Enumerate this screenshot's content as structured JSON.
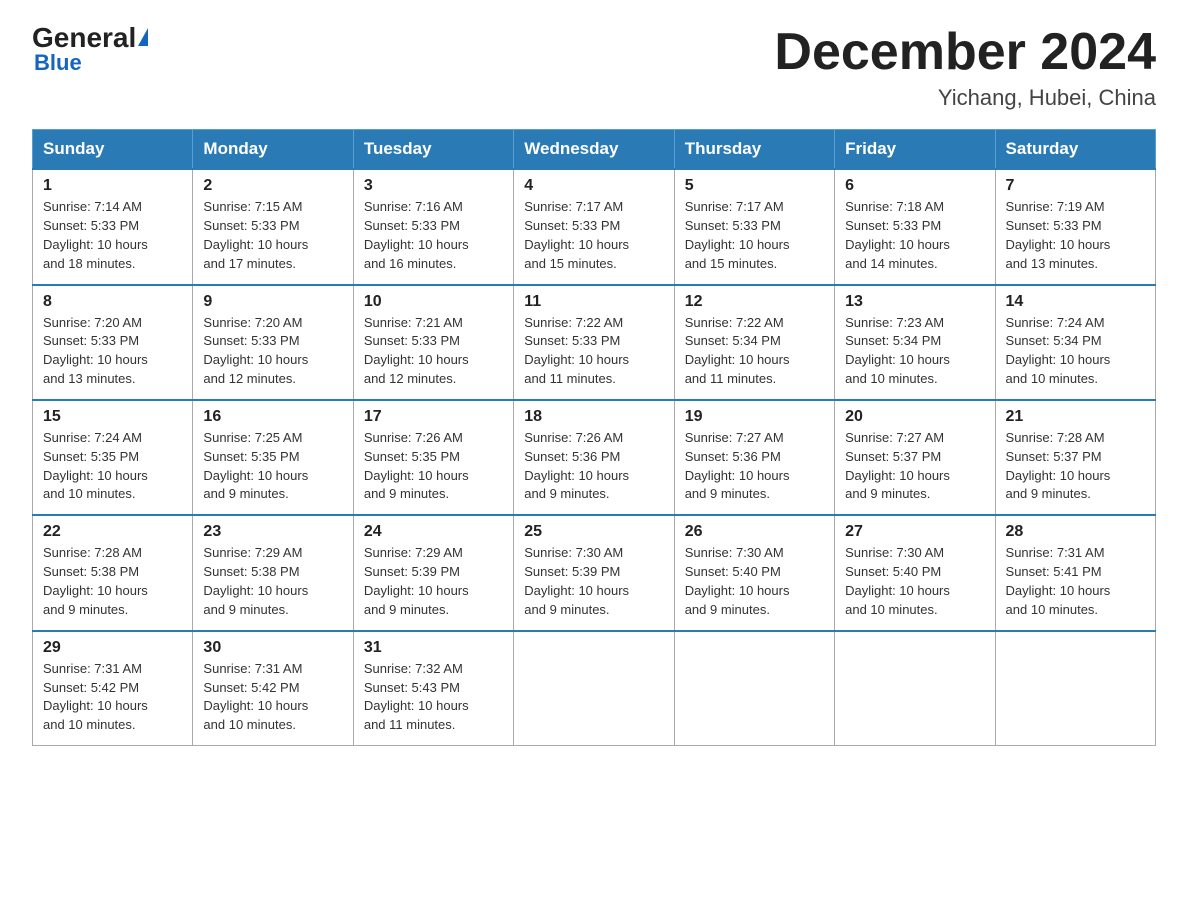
{
  "logo": {
    "general": "General",
    "blue": "Blue",
    "sub": "Blue"
  },
  "header": {
    "title": "December 2024",
    "location": "Yichang, Hubei, China"
  },
  "days_of_week": [
    "Sunday",
    "Monday",
    "Tuesday",
    "Wednesday",
    "Thursday",
    "Friday",
    "Saturday"
  ],
  "weeks": [
    [
      {
        "day": "1",
        "sunrise": "7:14 AM",
        "sunset": "5:33 PM",
        "daylight": "10 hours and 18 minutes."
      },
      {
        "day": "2",
        "sunrise": "7:15 AM",
        "sunset": "5:33 PM",
        "daylight": "10 hours and 17 minutes."
      },
      {
        "day": "3",
        "sunrise": "7:16 AM",
        "sunset": "5:33 PM",
        "daylight": "10 hours and 16 minutes."
      },
      {
        "day": "4",
        "sunrise": "7:17 AM",
        "sunset": "5:33 PM",
        "daylight": "10 hours and 15 minutes."
      },
      {
        "day": "5",
        "sunrise": "7:17 AM",
        "sunset": "5:33 PM",
        "daylight": "10 hours and 15 minutes."
      },
      {
        "day": "6",
        "sunrise": "7:18 AM",
        "sunset": "5:33 PM",
        "daylight": "10 hours and 14 minutes."
      },
      {
        "day": "7",
        "sunrise": "7:19 AM",
        "sunset": "5:33 PM",
        "daylight": "10 hours and 13 minutes."
      }
    ],
    [
      {
        "day": "8",
        "sunrise": "7:20 AM",
        "sunset": "5:33 PM",
        "daylight": "10 hours and 13 minutes."
      },
      {
        "day": "9",
        "sunrise": "7:20 AM",
        "sunset": "5:33 PM",
        "daylight": "10 hours and 12 minutes."
      },
      {
        "day": "10",
        "sunrise": "7:21 AM",
        "sunset": "5:33 PM",
        "daylight": "10 hours and 12 minutes."
      },
      {
        "day": "11",
        "sunrise": "7:22 AM",
        "sunset": "5:33 PM",
        "daylight": "10 hours and 11 minutes."
      },
      {
        "day": "12",
        "sunrise": "7:22 AM",
        "sunset": "5:34 PM",
        "daylight": "10 hours and 11 minutes."
      },
      {
        "day": "13",
        "sunrise": "7:23 AM",
        "sunset": "5:34 PM",
        "daylight": "10 hours and 10 minutes."
      },
      {
        "day": "14",
        "sunrise": "7:24 AM",
        "sunset": "5:34 PM",
        "daylight": "10 hours and 10 minutes."
      }
    ],
    [
      {
        "day": "15",
        "sunrise": "7:24 AM",
        "sunset": "5:35 PM",
        "daylight": "10 hours and 10 minutes."
      },
      {
        "day": "16",
        "sunrise": "7:25 AM",
        "sunset": "5:35 PM",
        "daylight": "10 hours and 9 minutes."
      },
      {
        "day": "17",
        "sunrise": "7:26 AM",
        "sunset": "5:35 PM",
        "daylight": "10 hours and 9 minutes."
      },
      {
        "day": "18",
        "sunrise": "7:26 AM",
        "sunset": "5:36 PM",
        "daylight": "10 hours and 9 minutes."
      },
      {
        "day": "19",
        "sunrise": "7:27 AM",
        "sunset": "5:36 PM",
        "daylight": "10 hours and 9 minutes."
      },
      {
        "day": "20",
        "sunrise": "7:27 AM",
        "sunset": "5:37 PM",
        "daylight": "10 hours and 9 minutes."
      },
      {
        "day": "21",
        "sunrise": "7:28 AM",
        "sunset": "5:37 PM",
        "daylight": "10 hours and 9 minutes."
      }
    ],
    [
      {
        "day": "22",
        "sunrise": "7:28 AM",
        "sunset": "5:38 PM",
        "daylight": "10 hours and 9 minutes."
      },
      {
        "day": "23",
        "sunrise": "7:29 AM",
        "sunset": "5:38 PM",
        "daylight": "10 hours and 9 minutes."
      },
      {
        "day": "24",
        "sunrise": "7:29 AM",
        "sunset": "5:39 PM",
        "daylight": "10 hours and 9 minutes."
      },
      {
        "day": "25",
        "sunrise": "7:30 AM",
        "sunset": "5:39 PM",
        "daylight": "10 hours and 9 minutes."
      },
      {
        "day": "26",
        "sunrise": "7:30 AM",
        "sunset": "5:40 PM",
        "daylight": "10 hours and 9 minutes."
      },
      {
        "day": "27",
        "sunrise": "7:30 AM",
        "sunset": "5:40 PM",
        "daylight": "10 hours and 10 minutes."
      },
      {
        "day": "28",
        "sunrise": "7:31 AM",
        "sunset": "5:41 PM",
        "daylight": "10 hours and 10 minutes."
      }
    ],
    [
      {
        "day": "29",
        "sunrise": "7:31 AM",
        "sunset": "5:42 PM",
        "daylight": "10 hours and 10 minutes."
      },
      {
        "day": "30",
        "sunrise": "7:31 AM",
        "sunset": "5:42 PM",
        "daylight": "10 hours and 10 minutes."
      },
      {
        "day": "31",
        "sunrise": "7:32 AM",
        "sunset": "5:43 PM",
        "daylight": "10 hours and 11 minutes."
      },
      null,
      null,
      null,
      null
    ]
  ],
  "labels": {
    "sunrise": "Sunrise:",
    "sunset": "Sunset:",
    "daylight": "Daylight:"
  }
}
